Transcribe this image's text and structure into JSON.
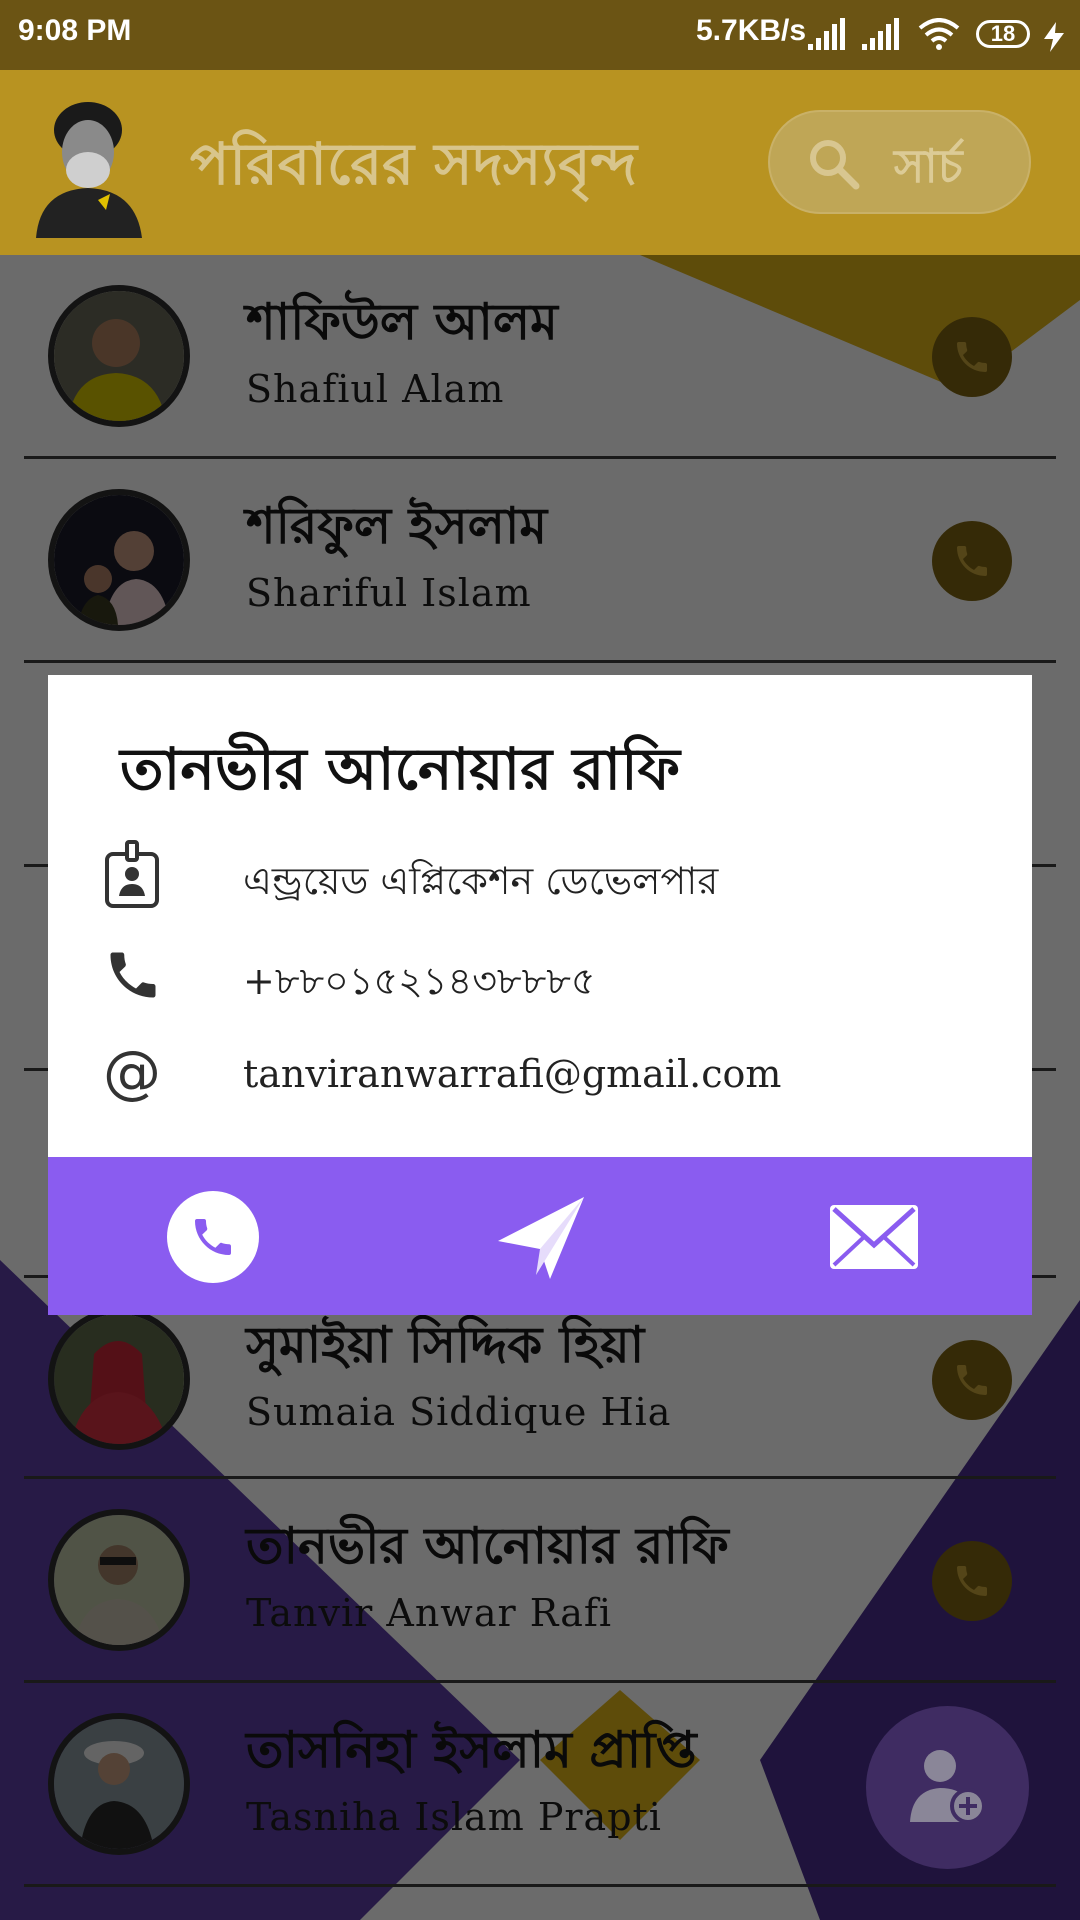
{
  "status_bar": {
    "time": "9:08 PM",
    "network_speed": "5.7KB/s",
    "battery": "18"
  },
  "header": {
    "title": "পরিবারের সদস্যবৃন্দ",
    "search_label": "সার্চ",
    "accent_color": "#b89321"
  },
  "members": [
    {
      "name_bn": "শাফিউল আলম",
      "name_en": "Shafiul Alam"
    },
    {
      "name_bn": "শরিফুল ইসলাম",
      "name_en": "Shariful Islam"
    },
    {
      "name_bn": "সুমাইয়া সিদ্দিক হিয়া",
      "name_en": "Sumaia Siddique Hia"
    },
    {
      "name_bn": "তানভীর আনোয়ার রাফি",
      "name_en": "Tanvir Anwar Rafi"
    },
    {
      "name_bn": "তাসনিহা ইসলাম প্রাপ্তি",
      "name_en": "Tasniha Islam Prapti"
    }
  ],
  "dialog": {
    "title": "তানভীর আনোয়ার রাফি",
    "occupation": "এন্ড্রয়েড এপ্লিকেশন ডেভেলপার",
    "phone": "+৮৮০১৫২১৪৩৮৮৮৫",
    "email": "tanviranwarrafi@gmail.com",
    "actions": [
      "call",
      "message",
      "email"
    ],
    "action_bar_color": "#8a5cf0"
  },
  "icons": {
    "search": "search-icon",
    "call": "phone-icon",
    "fab": "add-person-icon",
    "occupation": "id-badge-icon",
    "email": "at-icon",
    "message": "send-icon",
    "mail": "envelope-icon"
  }
}
